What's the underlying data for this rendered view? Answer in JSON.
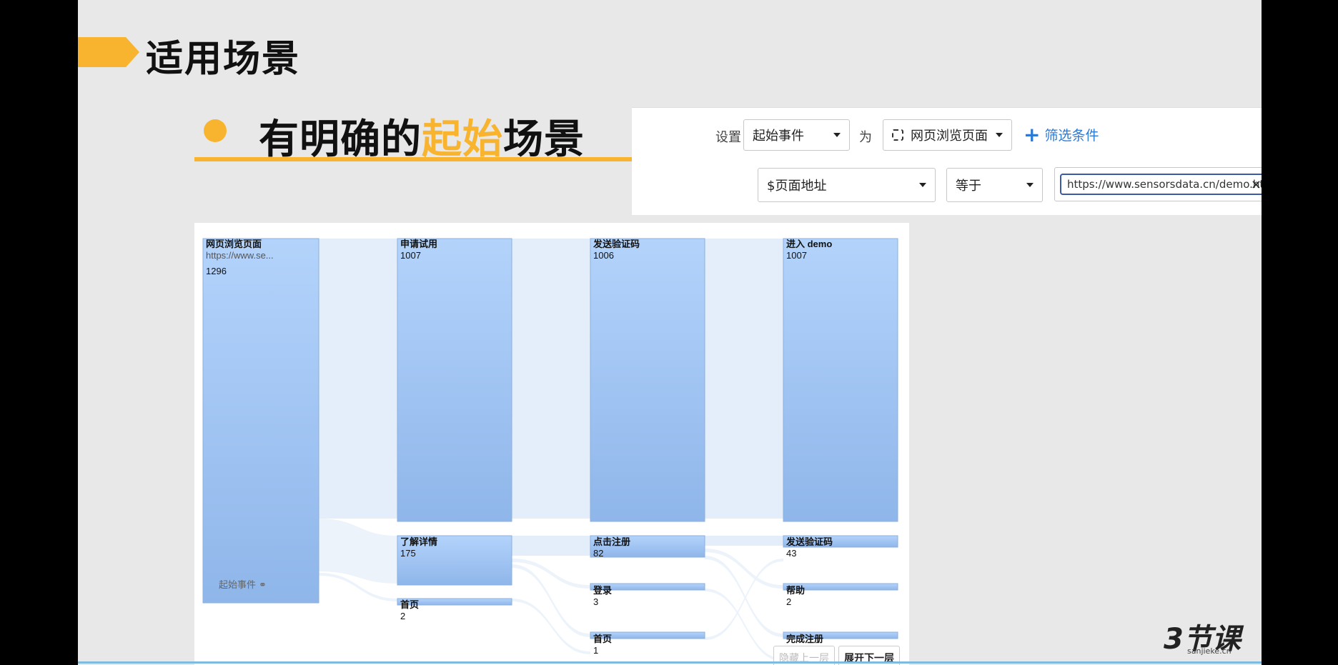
{
  "slide": {
    "title": "适用场景",
    "bullet_prefix": "有明确的",
    "bullet_highlight": "起始",
    "bullet_suffix": "场景"
  },
  "filter": {
    "set_label": "设置",
    "event_type": "起始事件",
    "as_label": "为",
    "event_name": "网页浏览页面",
    "add_filter_label": "筛选条件",
    "property": "$页面地址",
    "operator": "等于",
    "value": "https://www.sensorsdata.cn/demo.html",
    "remove_icon": "×"
  },
  "flow": {
    "start_label": "起始事件",
    "buttons": {
      "hide_prev": "隐藏上一层",
      "expand_next": "展开下一层"
    },
    "nodes": [
      {
        "name": "网页浏览页面",
        "sub": "https://www.se...",
        "value": "1296"
      },
      {
        "name": "申请试用",
        "value": "1007"
      },
      {
        "name": "了解详情",
        "value": "175"
      },
      {
        "name": "首页",
        "value": "2"
      },
      {
        "name": "发送验证码",
        "value": "1006"
      },
      {
        "name": "点击注册",
        "value": "82"
      },
      {
        "name": "登录",
        "value": "3"
      },
      {
        "name": "首页",
        "value": "1"
      },
      {
        "name": "进入 demo",
        "value": "1007"
      },
      {
        "name": "发送验证码",
        "value": "43"
      },
      {
        "name": "帮助",
        "value": "2"
      },
      {
        "name": "完成注册",
        "value": ""
      }
    ]
  },
  "brand": {
    "logo": "3节课",
    "domain": "sanjieke.cn"
  }
}
